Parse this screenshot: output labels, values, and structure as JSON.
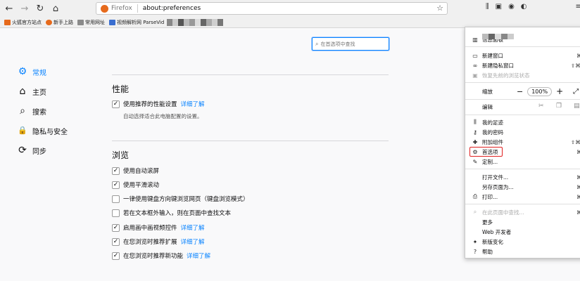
{
  "browser": {
    "url_brand": "Firefox",
    "url": "about:preferences",
    "bookmarks": [
      {
        "label": "火狐官方站点",
        "color": "#e66a1c"
      },
      {
        "label": "新手上路",
        "color": "#e66a1c"
      },
      {
        "label": "常用网址",
        "color": "#8a8a8a"
      },
      {
        "label": "视频解析网 ParseVid",
        "color": "#3a6ed0"
      }
    ]
  },
  "search": {
    "placeholder": "在首选项中查找"
  },
  "sidebar": [
    {
      "label": "常规",
      "icon": "gear-icon",
      "glyph": "⚙",
      "active": true
    },
    {
      "label": "主页",
      "icon": "home-icon",
      "glyph": "⌂",
      "active": false
    },
    {
      "label": "搜索",
      "icon": "search-icon",
      "glyph": "⌕",
      "active": false
    },
    {
      "label": "隐私与安全",
      "icon": "lock-icon",
      "glyph": "🔒",
      "active": false
    },
    {
      "label": "同步",
      "icon": "sync-icon",
      "glyph": "⟳",
      "active": false
    }
  ],
  "performance": {
    "title": "性能",
    "option": "使用推荐的性能设置",
    "link": "详细了解",
    "desc": "自动选择适合此电脑配置的设置。"
  },
  "browsing": {
    "title": "浏览",
    "options": [
      {
        "label": "使用自动滚屏",
        "checked": true,
        "link": ""
      },
      {
        "label": "使用平滑滚动",
        "checked": true,
        "link": ""
      },
      {
        "label": "一律使用键盘方向键浏览网页（键盘浏览模式）",
        "checked": false,
        "link": ""
      },
      {
        "label": "若在文本框外输入，则在页面中查找文本",
        "checked": false,
        "link": ""
      },
      {
        "label": "启用画中画视频控件",
        "checked": true,
        "link": "详细了解"
      },
      {
        "label": "在您浏览时推荐扩展",
        "checked": true,
        "link": "详细了解"
      },
      {
        "label": "在您浏览时推荐新功能",
        "checked": true,
        "link": "详细了解"
      }
    ]
  },
  "menu": {
    "dashboard": "信息面板",
    "new_window": "新建窗口",
    "new_window_sc": "⌘N",
    "private_window": "新建隐私窗口",
    "private_window_sc": "⇧⌘P",
    "restore": "恢复先前的浏览状态",
    "zoom_label": "缩放",
    "zoom_minus": "−",
    "zoom_value": "100%",
    "zoom_plus": "+",
    "edit_label": "编辑",
    "library": "我的足迹",
    "logins": "我的密码",
    "addons": "附加组件",
    "addons_sc": "⇧⌘A",
    "preferences": "首选项",
    "preferences_sc": "⌘,",
    "customize": "定制...",
    "open_file": "打开文件...",
    "open_file_sc": "⌘O",
    "save_page": "另存页面为...",
    "save_page_sc": "⌘S",
    "print": "打印...",
    "print_sc": "⌘P",
    "find": "在此页面中查找...",
    "find_sc": "⌘F",
    "more": "更多",
    "web_dev": "Web 开发者",
    "whats_new": "新版变化",
    "help": "帮助"
  }
}
